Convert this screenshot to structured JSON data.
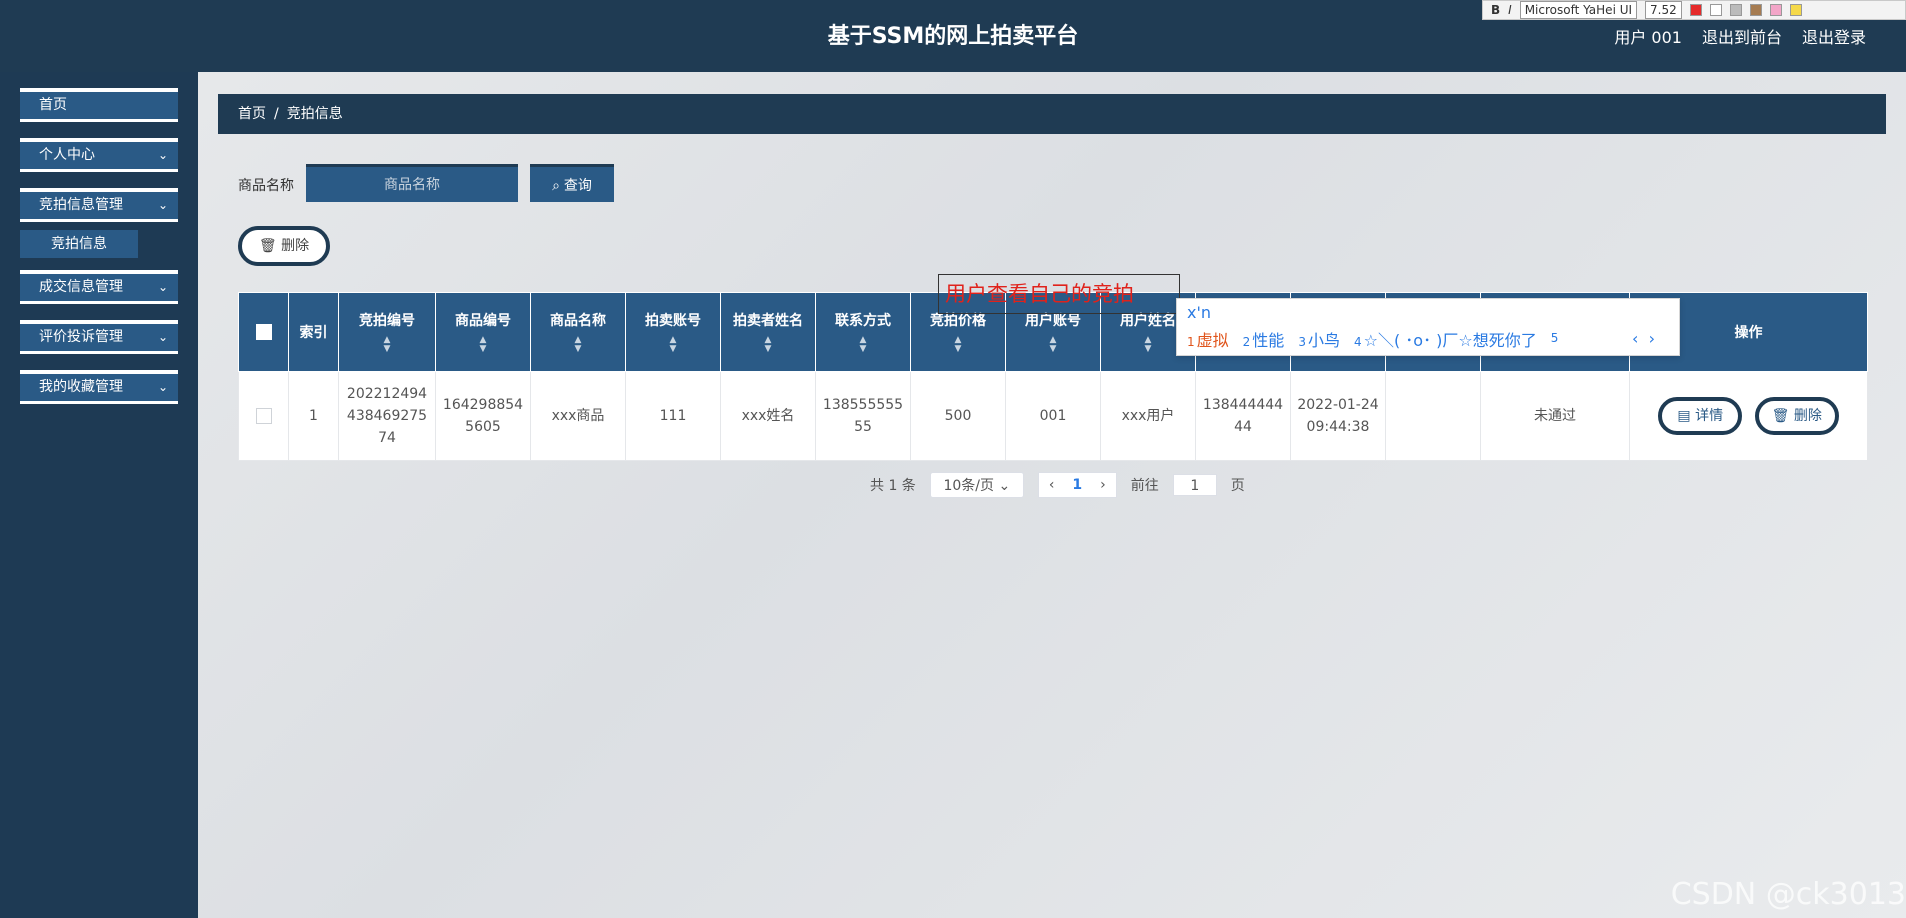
{
  "header": {
    "title": "基于SSM的网上拍卖平台",
    "user": "用户 001",
    "to_front": "退出到前台",
    "logout": "退出登录"
  },
  "format_toolbar": {
    "bold": "B",
    "italic": "I",
    "font": "Microsoft YaHei UI",
    "size": "7.52"
  },
  "sidebar": {
    "items": [
      {
        "label": "首页"
      },
      {
        "label": "个人中心"
      },
      {
        "label": "竞拍信息管理"
      },
      {
        "label": "成交信息管理"
      },
      {
        "label": "评价投诉管理"
      },
      {
        "label": "我的收藏管理"
      }
    ],
    "sub_item": "竞拍信息"
  },
  "breadcrumb": {
    "home": "首页",
    "sep": "/",
    "current": "竞拍信息"
  },
  "search": {
    "label": "商品名称",
    "placeholder": "商品名称",
    "button": "查询"
  },
  "actions": {
    "delete": "删除"
  },
  "table": {
    "headers": [
      "索引",
      "竞拍编号",
      "商品编号",
      "商品名称",
      "拍卖账号",
      "拍卖者姓名",
      "联系方式",
      "竞拍价格",
      "用户账号",
      "用户姓名",
      "",
      "",
      "",
      "",
      "操作"
    ],
    "rows": [
      {
        "index": "1",
        "bid_no": "20221249443846927574",
        "goods_no": "1642988545605",
        "goods_name": "xxx商品",
        "seller_account": "111",
        "seller_name": "xxx姓名",
        "contact": "13855555555",
        "price": "500",
        "user_account": "001",
        "user_name": "xxx用户",
        "phone": "13844444444",
        "time": "2022-01-24 09:44:38",
        "reply": "",
        "status": "未通过",
        "detail": "详情",
        "delete": "删除"
      }
    ]
  },
  "pagination": {
    "total": "共 1 条",
    "page_size": "10条/页",
    "current": "1",
    "goto": "前往",
    "goto_value": "1",
    "page_unit": "页"
  },
  "overlay": {
    "annotation": "用户查看自己的竞拍",
    "ime_composition": "x'n",
    "ime_candidates": [
      {
        "n": "1",
        "text": "虚拟"
      },
      {
        "n": "2",
        "text": "性能"
      },
      {
        "n": "3",
        "text": "小鸟"
      },
      {
        "n": "4",
        "text": "☆＼( ･o･ )厂☆想死你了"
      },
      {
        "n": "5",
        "text": ""
      }
    ]
  },
  "watermark": "CSDN @ck3013"
}
